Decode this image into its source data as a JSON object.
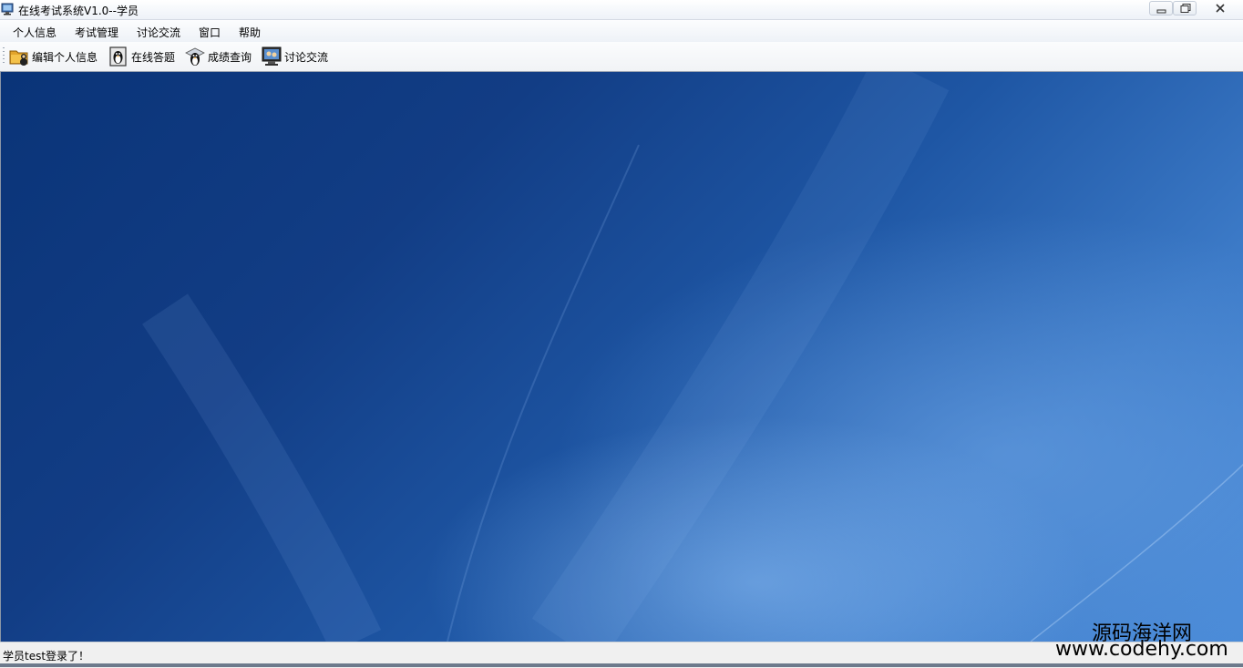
{
  "window": {
    "title": "在线考试系统V1.0--学员"
  },
  "menu": {
    "items": [
      {
        "label": "个人信息"
      },
      {
        "label": "考试管理"
      },
      {
        "label": "讨论交流"
      },
      {
        "label": "窗口"
      },
      {
        "label": "帮助"
      }
    ]
  },
  "toolbar": {
    "buttons": [
      {
        "label": "编辑个人信息",
        "icon": "folder-user-icon"
      },
      {
        "label": "在线答题",
        "icon": "exam-penguin-icon"
      },
      {
        "label": "成绩查询",
        "icon": "score-penguin-icon"
      },
      {
        "label": "讨论交流",
        "icon": "discussion-monitor-icon"
      }
    ]
  },
  "statusbar": {
    "message": "学员test登录了！"
  },
  "watermark": {
    "name": "源码海洋网",
    "url": "www.codehy.com"
  },
  "colors": {
    "desktop_dark": "#0a3478",
    "desktop_light": "#4a8bd8",
    "chrome": "#f0f0f0"
  }
}
